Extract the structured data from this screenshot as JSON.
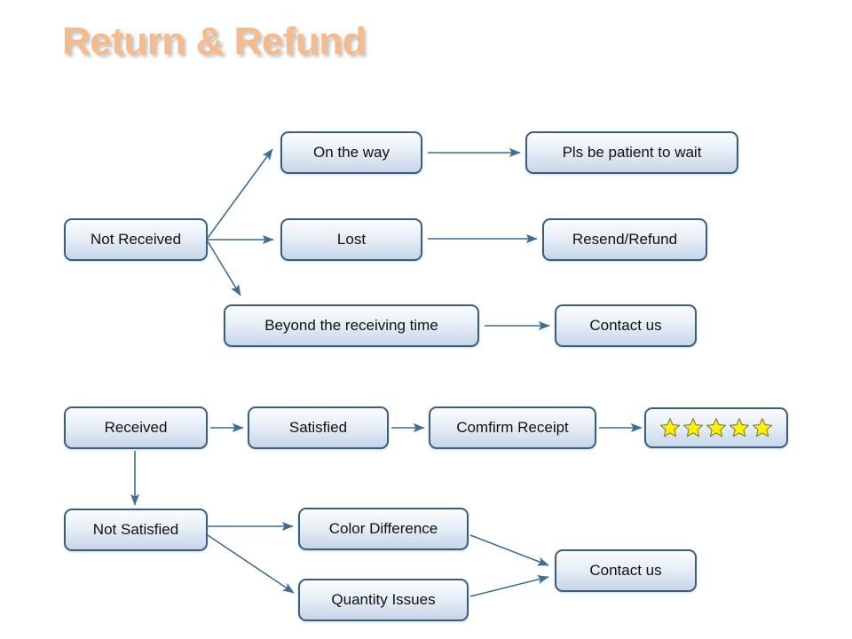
{
  "page": {
    "title": "Return & Refund",
    "title_color": "#F6BB8B",
    "background_color": "#FFFFFF",
    "box_border_color": "#3A5F7D",
    "box_fill_top_color": "#FBFCFE",
    "box_fill_bottom_color": "#C7D6EA",
    "arrow_color": "#3E6E96",
    "star_fill_color": "#FFF200",
    "star_outline_color": "#7A7A33"
  },
  "flow": {
    "not_received_branch": {
      "source_label": "Not Received",
      "steps": [
        {
          "cause_label": "On the way",
          "action_label": "Pls be patient to wait"
        },
        {
          "cause_label": "Lost",
          "action_label": "Resend/Refund"
        },
        {
          "cause_label": "Beyond the receiving time",
          "action_label": "Contact us"
        }
      ]
    },
    "received_branch": {
      "source_label": "Received",
      "satisfied_label": "Satisfied",
      "confirm_label": "Comfirm Receipt",
      "rating": {
        "stars_filled": 5,
        "star_glyph": "star-icon"
      },
      "not_satisfied_label": "Not Satisfied",
      "issues": [
        {
          "label": "Color Difference"
        },
        {
          "label": "Quantity Issues"
        }
      ],
      "issue_action_label": "Contact us"
    }
  }
}
